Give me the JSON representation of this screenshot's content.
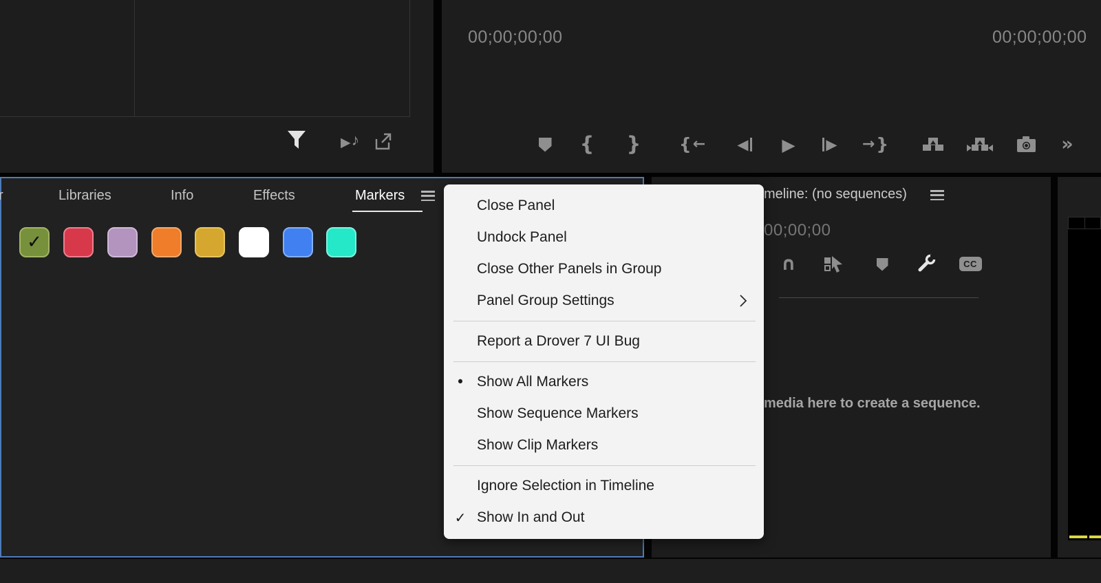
{
  "colors": {
    "panel_bg": "#1d1d1d",
    "markers_panel_bg": "#212121",
    "focus_border_blue": "#4d7cba",
    "menu_bg": "#f3f3f3",
    "icon_gray": "#8f8f8f",
    "icon_bright": "#e3e3e3",
    "meter_yellow": "#d9d943"
  },
  "icons": {
    "check": "✓",
    "bullet": "•",
    "play": "▶",
    "reverse": "◀",
    "brace_open": "{",
    "brace_close": "}",
    "arrow_left": "←",
    "arrow_right": "→",
    "note": "♪",
    "magnet": "∩",
    "more_chevrons": "»",
    "cc_label": "CC"
  },
  "project_panel": {
    "toolbar_icons": [
      "filter-icon",
      "play-audio-preview-icon",
      "export-icon"
    ]
  },
  "monitor_panel": {
    "timecode_position": "00;00;00;00",
    "timecode_duration": "00;00;00;00",
    "toolbar_icons": [
      "add-marker-icon",
      "mark-in-icon",
      "mark-out-icon",
      "go-to-in-icon",
      "step-back-icon",
      "play-icon",
      "step-forward-icon",
      "go-to-out-icon",
      "insert-icon",
      "overwrite-icon",
      "export-frame-icon",
      "more-icon"
    ]
  },
  "markers_panel": {
    "tabs": [
      {
        "label": "r",
        "partial": true,
        "active": false
      },
      {
        "label": "Libraries",
        "active": false
      },
      {
        "label": "Info",
        "active": false
      },
      {
        "label": "Effects",
        "active": false
      },
      {
        "label": "Markers",
        "active": true
      }
    ],
    "swatches": [
      {
        "name": "green",
        "color": "#77903c",
        "border": "#a3b464",
        "checked": true
      },
      {
        "name": "red",
        "color": "#d8394a",
        "border": "#ea8090",
        "checked": false
      },
      {
        "name": "mauve",
        "color": "#b394be",
        "border": "#d0b8d8",
        "checked": false
      },
      {
        "name": "orange",
        "color": "#ef7d2a",
        "border": "#f4a96b",
        "checked": false
      },
      {
        "name": "gold",
        "color": "#d6a72e",
        "border": "#e5c561",
        "checked": false
      },
      {
        "name": "white",
        "color": "#ffffff",
        "border": "#ffffff",
        "checked": false
      },
      {
        "name": "blue",
        "color": "#4080f0",
        "border": "#86b0f6",
        "checked": false
      },
      {
        "name": "teal",
        "color": "#25e8c8",
        "border": "#7ff2de",
        "checked": false
      }
    ]
  },
  "context_menu": {
    "items": [
      {
        "label": "Close Panel"
      },
      {
        "label": "Undock Panel"
      },
      {
        "label": "Close Other Panels in Group"
      },
      {
        "label": "Panel Group Settings",
        "submenu": true
      },
      {
        "separator": true
      },
      {
        "label": "Report a Drover 7 UI Bug"
      },
      {
        "separator": true
      },
      {
        "label": "Show All Markers",
        "glyph": "bullet"
      },
      {
        "label": "Show Sequence Markers"
      },
      {
        "label": "Show Clip Markers"
      },
      {
        "separator": true
      },
      {
        "label": "Ignore Selection in Timeline"
      },
      {
        "label": "Show In and Out",
        "glyph": "check"
      }
    ]
  },
  "timeline_panel": {
    "tab_label": "meline: (no sequences)",
    "timecode": "00;00;00",
    "drop_hint": "media here to create a sequence.",
    "toolbar_icons": [
      "snap-magnet-icon",
      "linked-selection-icon",
      "marker-icon",
      "settings-wrench-icon",
      "captions-icon"
    ]
  }
}
